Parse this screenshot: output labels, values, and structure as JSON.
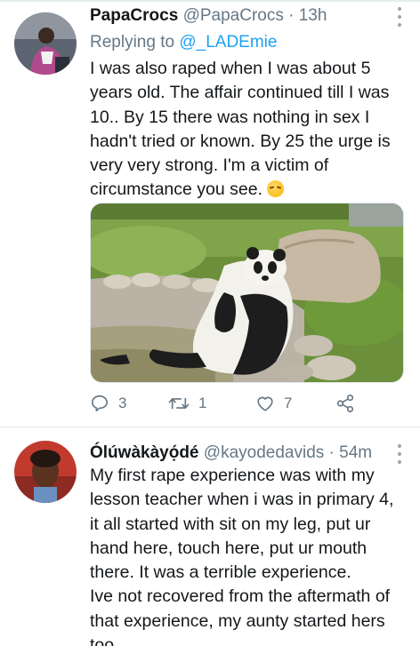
{
  "tweets": [
    {
      "name": "PapaCrocs",
      "handle": "@PapaCrocs",
      "dot": "·",
      "time": "13h",
      "reply_prefix": "Replying to ",
      "reply_to": "@_LADEmie",
      "text": "I was also raped when I was about 5 years old. The affair continued till I was 10.. By 15 there was nothing in sex I hadn't tried or known. By 25 the urge is very very strong. I'm a victim of circumstance you see.",
      "emoji": "pensive-face",
      "media": "panda-photo",
      "stats": {
        "replies": "3",
        "retweets": "1",
        "likes": "7"
      }
    },
    {
      "name": "Ólúwàkàyọ́dé",
      "handle": "@kayodedavids",
      "dot": "·",
      "time": "54m",
      "text": "My first rape experience was with my lesson teacher when i was in primary 4, it all started with sit on my leg, put ur hand here, touch here, put ur mouth there. It was a terrible experience.\nIve not recovered from the aftermath of that experience, my aunty started hers too"
    }
  ],
  "colors": {
    "text": "#14171a",
    "secondary": "#657786",
    "link": "#1da1f2",
    "divider": "#e1e8ed"
  },
  "icons": [
    "reply-icon",
    "retweet-icon",
    "like-icon",
    "share-icon",
    "more-icon"
  ]
}
